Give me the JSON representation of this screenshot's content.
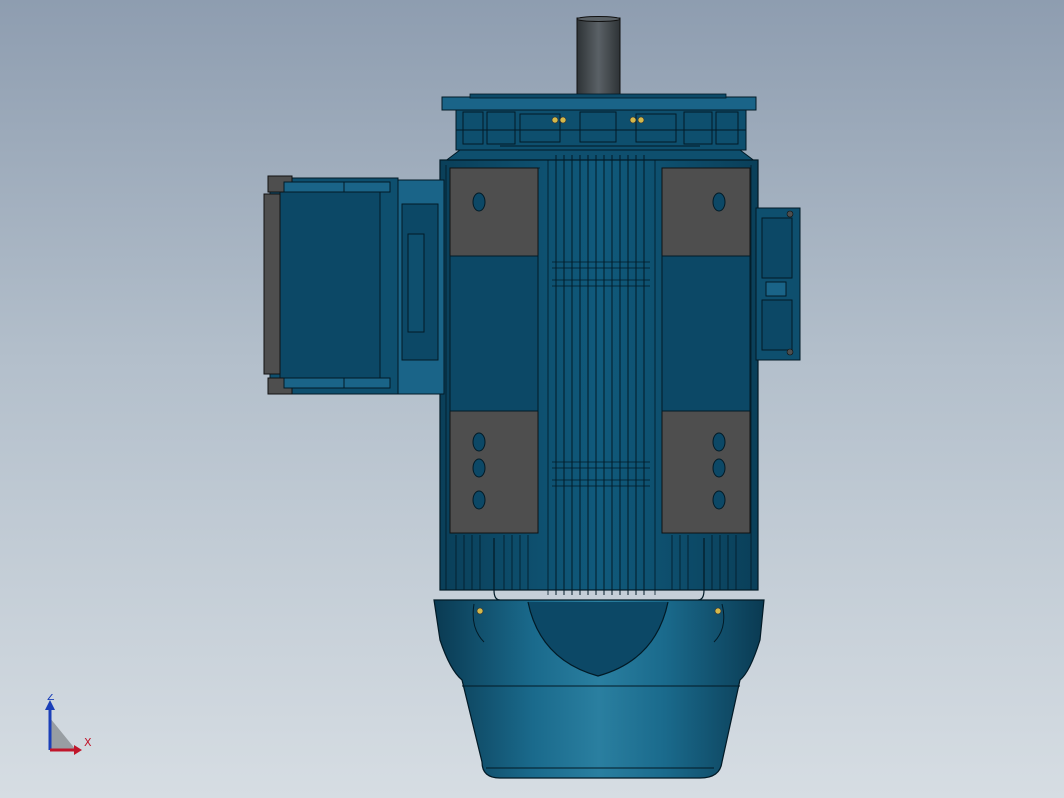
{
  "viewport": {
    "background_top": "#8e9db0",
    "background_bottom": "#d6dde3"
  },
  "model": {
    "body_color": "#0e4f6e",
    "body_dark": "#093a52",
    "edge_color": "#021a26",
    "pad_color": "#4e4e4e",
    "shaft_color": "#3f4449"
  },
  "triad": {
    "z_label": "Z",
    "x_label": "X",
    "z_color": "#1b3fb8",
    "x_color": "#c0162b"
  }
}
